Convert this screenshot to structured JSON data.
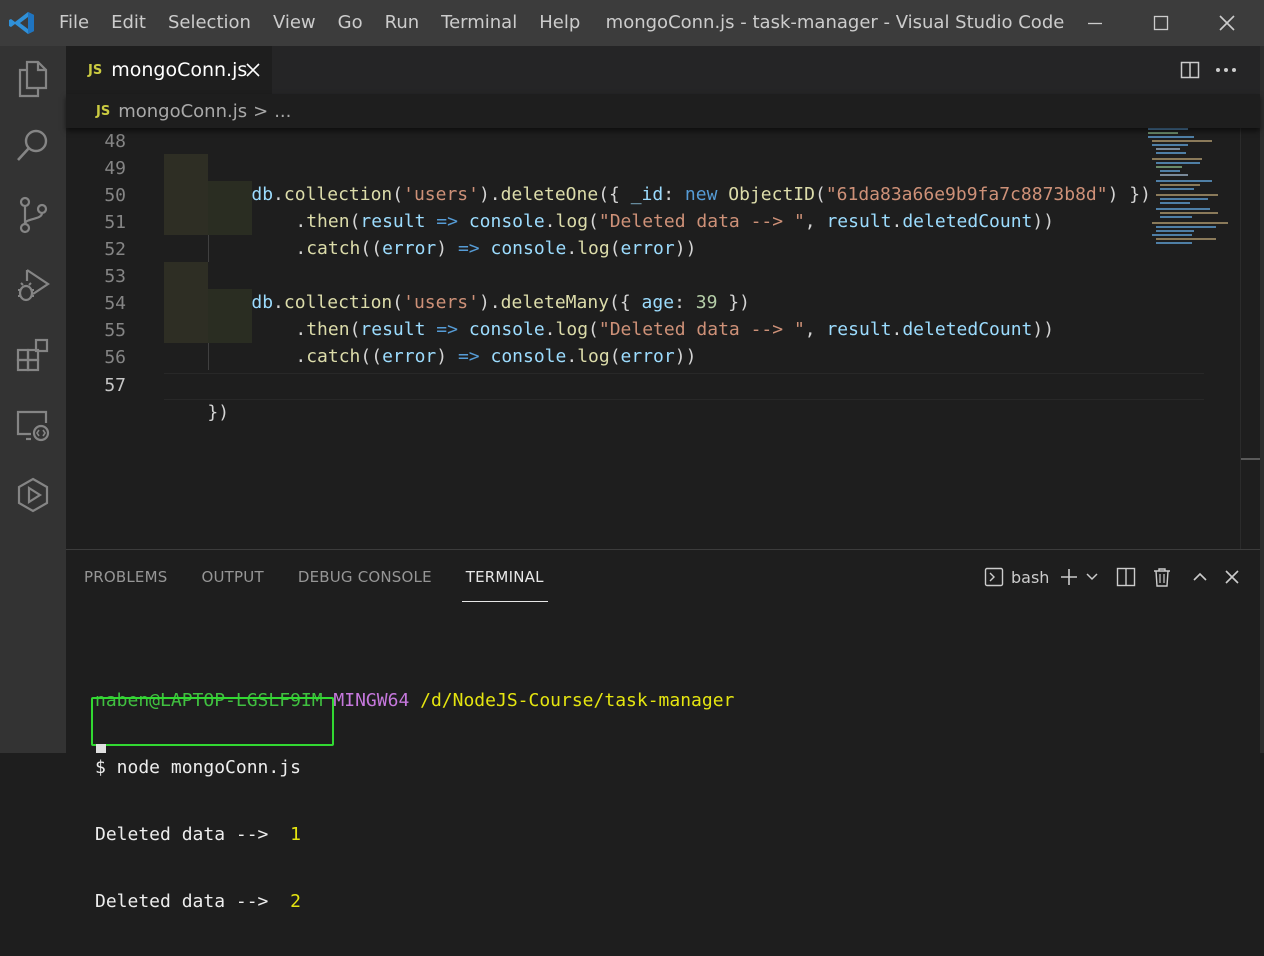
{
  "window": {
    "title": "mongoConn.js - task-manager - Visual Studio Code",
    "menu": [
      "File",
      "Edit",
      "Selection",
      "View",
      "Go",
      "Run",
      "Terminal",
      "Help"
    ],
    "controls": [
      "minimize-icon",
      "maximize-icon",
      "close-icon"
    ]
  },
  "activity_bar": [
    "explorer-icon",
    "search-icon",
    "source-control-icon",
    "run-debug-icon",
    "extensions-icon",
    "remote-explorer-icon",
    "test-icon"
  ],
  "tab": {
    "badge": "JS",
    "label": "mongoConn.js"
  },
  "breadcrumb": {
    "badge": "JS",
    "file": "mongoConn.js",
    "separator": ">",
    "more": "..."
  },
  "editor": {
    "lines": [
      {
        "num": "48"
      },
      {
        "num": "49"
      },
      {
        "num": "50"
      },
      {
        "num": "51"
      },
      {
        "num": "52"
      },
      {
        "num": "53"
      },
      {
        "num": "54"
      },
      {
        "num": "55"
      },
      {
        "num": "56"
      },
      {
        "num": "57"
      }
    ],
    "code": {
      "l49": [
        "db",
        ".",
        "collection",
        "(",
        "'users'",
        ").",
        "deleteOne",
        "({ ",
        "_id",
        ": ",
        "new",
        " ",
        "ObjectID",
        "(",
        "\"61da83a66e9b9fa7c8873b8d\"",
        ") })"
      ],
      "l50": [
        ".",
        "then",
        "(",
        "result",
        " ",
        "=>",
        " ",
        "console",
        ".",
        "log",
        "(",
        "\"Deleted data --> \"",
        ", ",
        "result",
        ".",
        "deletedCount",
        "))"
      ],
      "l51": [
        ".",
        "catch",
        "((",
        "error",
        ") ",
        "=>",
        " ",
        "console",
        ".",
        "log",
        "(",
        "error",
        "))"
      ],
      "l53": [
        "db",
        ".",
        "collection",
        "(",
        "'users'",
        ").",
        "deleteMany",
        "({ ",
        "age",
        ": ",
        "39",
        " })"
      ],
      "l54": [
        ".",
        "then",
        "(",
        "result",
        " ",
        "=>",
        " ",
        "console",
        ".",
        "log",
        "(",
        "\"Deleted data --> \"",
        ", ",
        "result",
        ".",
        "deletedCount",
        "))"
      ],
      "l55": [
        ".",
        "catch",
        "((",
        "error",
        ") ",
        "=>",
        " ",
        "console",
        ".",
        "log",
        "(",
        "error",
        "))"
      ],
      "l57": [
        "})"
      ]
    }
  },
  "panel": {
    "tabs": [
      "PROBLEMS",
      "OUTPUT",
      "DEBUG CONSOLE",
      "TERMINAL"
    ],
    "active_tab": "TERMINAL",
    "shell": "bash"
  },
  "terminal": {
    "user": "naben@LAPTOP-LGSLF9IM",
    "env": "MINGW64",
    "path": "/d/NodeJS-Course/task-manager",
    "command": "$ node mongoConn.js",
    "outputs": [
      {
        "text": "Deleted data --> ",
        "value": "1"
      },
      {
        "text": "Deleted data --> ",
        "value": "2"
      }
    ]
  },
  "colors": {
    "highlight_box": "#32d932",
    "titlebar": "#3c3c3c",
    "activity_bar": "#333333",
    "editor_bg": "#1e1e1e"
  }
}
